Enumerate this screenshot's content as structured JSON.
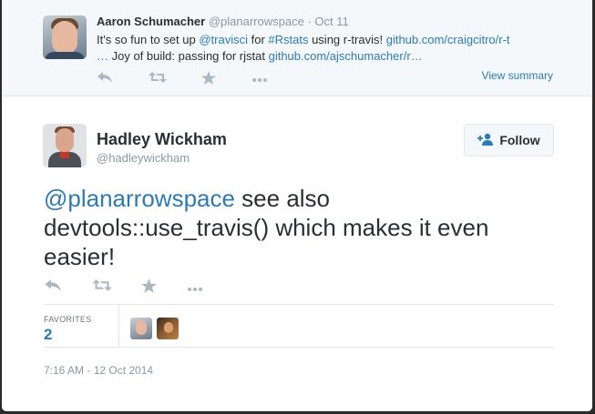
{
  "parent_tweet": {
    "name": "Aaron Schumacher",
    "handle": "@planarrowspace",
    "separator": "·",
    "date": "Oct 11",
    "line1": {
      "t1": "It's so fun to set up ",
      "mention": "@travisci",
      "t2": " for ",
      "hashtag": "#Rstats",
      "t3": " using r-travis! ",
      "link1": "github.com/craigcitro/r-t"
    },
    "line2": {
      "link_prefix": "…",
      "t4": " Joy of build: passing for rjstat ",
      "link2": "github.com/ajschumacher/r…"
    },
    "view_summary": "View summary"
  },
  "main_tweet": {
    "name": "Hadley Wickham",
    "handle": "@hadleywickham",
    "follow_label": "Follow",
    "mention": "@planarrowspace",
    "text": " see also devtools::use_travis() which makes it even easier!",
    "favorites_label": "FAVORITES",
    "favorites_count": "2",
    "timestamp": "7:16 AM - 12 Oct 2014"
  },
  "icons": {
    "reply": "reply-icon",
    "retweet": "retweet-icon",
    "favorite": "star-icon",
    "more": "more-icon",
    "follow": "add-user-icon"
  },
  "colors": {
    "link": "#2b7bb9",
    "muted": "#8899a6",
    "action": "#aab8c2",
    "text": "#292f33",
    "parent_bg": "#f5f8fa"
  }
}
